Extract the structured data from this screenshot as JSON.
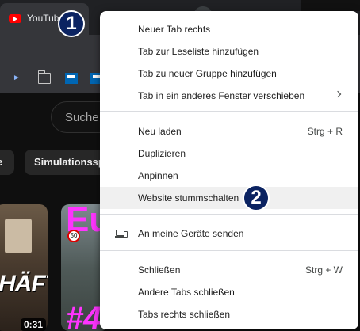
{
  "browser": {
    "tab_title": "YouTub",
    "colors": {
      "tab_bg": "#35363a",
      "strip_bg": "#202124",
      "youtube_red": "#ff0000"
    },
    "bookmark_icons": [
      "chevron-icon",
      "folder-icon",
      "volksbank-icon",
      "volksbank-icon"
    ]
  },
  "youtube": {
    "search_placeholder": "Suche",
    "chips": [
      "e",
      "Simulationssp"
    ],
    "thumbnails": [
      {
        "caption": "HÄFT",
        "duration": "0:31"
      },
      {
        "caption_top": "Eu",
        "caption_bottom": "#4",
        "sign": "50"
      }
    ]
  },
  "context_menu": {
    "groups": [
      [
        {
          "label": "Neuer Tab rechts"
        },
        {
          "label": "Tab zur Leseliste hinzufügen"
        },
        {
          "label": "Tab zu neuer Gruppe hinzufügen"
        },
        {
          "label": "Tab in ein anderes Fenster verschieben",
          "submenu": true
        }
      ],
      [
        {
          "label": "Neu laden",
          "shortcut": "Strg + R"
        },
        {
          "label": "Duplizieren"
        },
        {
          "label": "Anpinnen"
        },
        {
          "label": "Website stummschalten",
          "highlighted": true
        }
      ],
      [
        {
          "label": "An meine Geräte senden",
          "icon": "devices-icon"
        }
      ],
      [
        {
          "label": "Schließen",
          "shortcut": "Strg + W"
        },
        {
          "label": "Andere Tabs schließen"
        },
        {
          "label": "Tabs rechts schließen"
        }
      ]
    ],
    "highlight_color": "#f0f0f0"
  },
  "annotations": {
    "step1": "1",
    "step2": "2",
    "badge_color": "#0b2361"
  }
}
